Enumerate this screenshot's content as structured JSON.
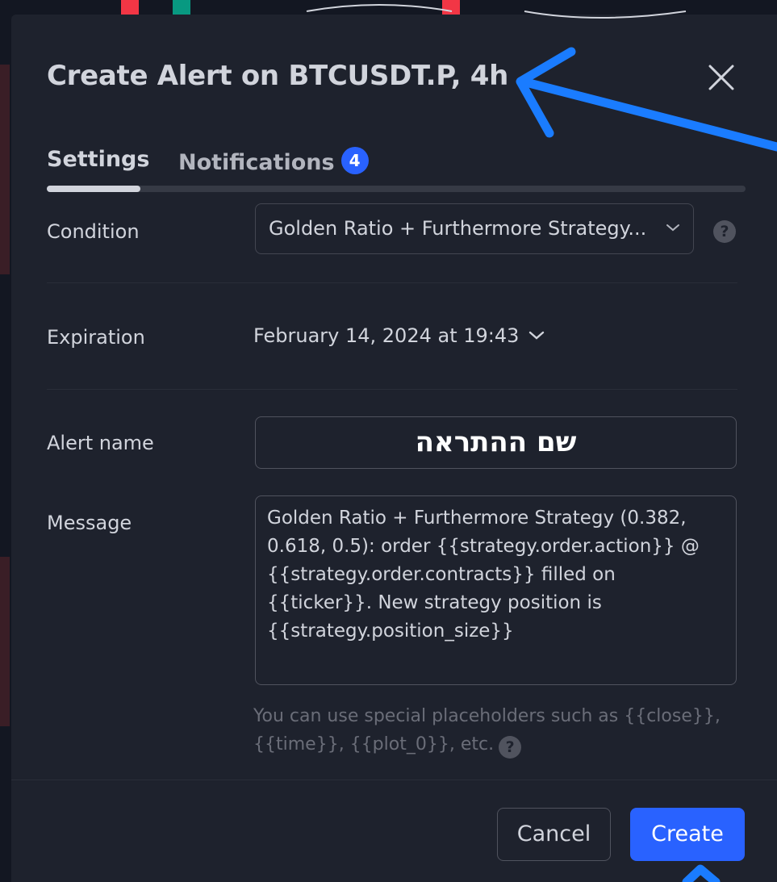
{
  "dialog": {
    "title": "Create Alert on BTCUSDT.P, 4h"
  },
  "tabs": [
    {
      "label": "Settings",
      "active": true
    },
    {
      "label": "Notifications",
      "badge": "4",
      "active": false
    }
  ],
  "form": {
    "condition": {
      "label": "Condition",
      "value": "Golden Ratio + Furthermore Strategy..."
    },
    "expiration": {
      "label": "Expiration",
      "value": "February 14, 2024 at 19:43"
    },
    "alert_name": {
      "label": "Alert name",
      "value": "שם ההתראה"
    },
    "message": {
      "label": "Message",
      "value": "Golden Ratio + Furthermore Strategy (0.382, 0.618, 0.5): order {{strategy.order.action}} @ {{strategy.order.contracts}} filled on {{ticker}}. New strategy position is {{strategy.position_size}}"
    },
    "hint": "You can use special placeholders such as {{close}}, {{time}}, {{plot_0}}, etc.",
    "help_glyph": "?"
  },
  "buttons": {
    "cancel": "Cancel",
    "create": "Create"
  },
  "icons": {
    "close": "close-icon",
    "chevron": "chevron-down-icon",
    "help": "help-icon"
  },
  "colors": {
    "dialog_bg": "#1e222d",
    "accent": "#2962ff",
    "annotation_arrow": "#1a7cff",
    "text": "#d1d4dc",
    "muted": "#6a6d78"
  }
}
